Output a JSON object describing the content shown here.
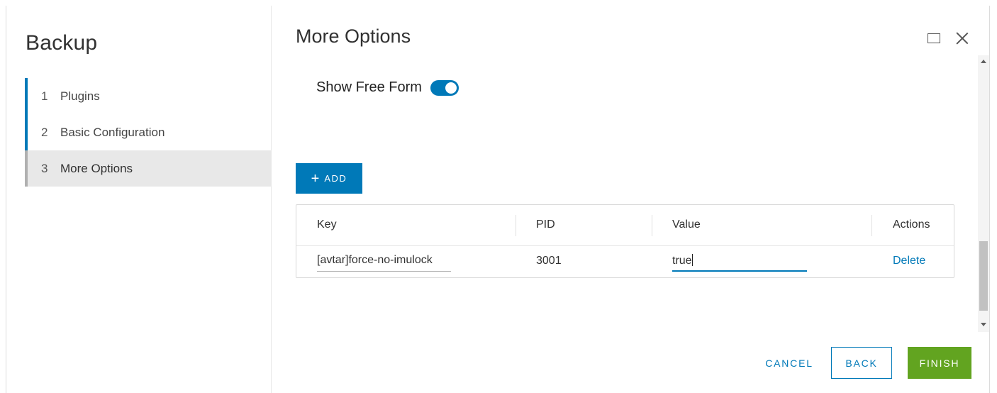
{
  "sidebar": {
    "title": "Backup",
    "steps": [
      {
        "number": "1",
        "label": "Plugins"
      },
      {
        "number": "2",
        "label": "Basic Configuration"
      },
      {
        "number": "3",
        "label": "More Options"
      }
    ]
  },
  "main": {
    "title": "More Options",
    "toggle": {
      "label": "Show Free Form",
      "checked": true
    },
    "add_button": {
      "icon": "plus-icon",
      "label": "ADD"
    },
    "table": {
      "columns": [
        "Key",
        "PID",
        "Value",
        "Actions"
      ],
      "rows": [
        {
          "key": "[avtar]force-no-imulock",
          "pid": "3001",
          "value": "true",
          "action": "Delete"
        }
      ]
    }
  },
  "footer": {
    "cancel_label": "CANCEL",
    "back_label": "BACK",
    "finish_label": "FINISH"
  },
  "colors": {
    "accent": "#0079b8",
    "finish": "#62a420",
    "active_step_bg": "#e8e8e8"
  }
}
